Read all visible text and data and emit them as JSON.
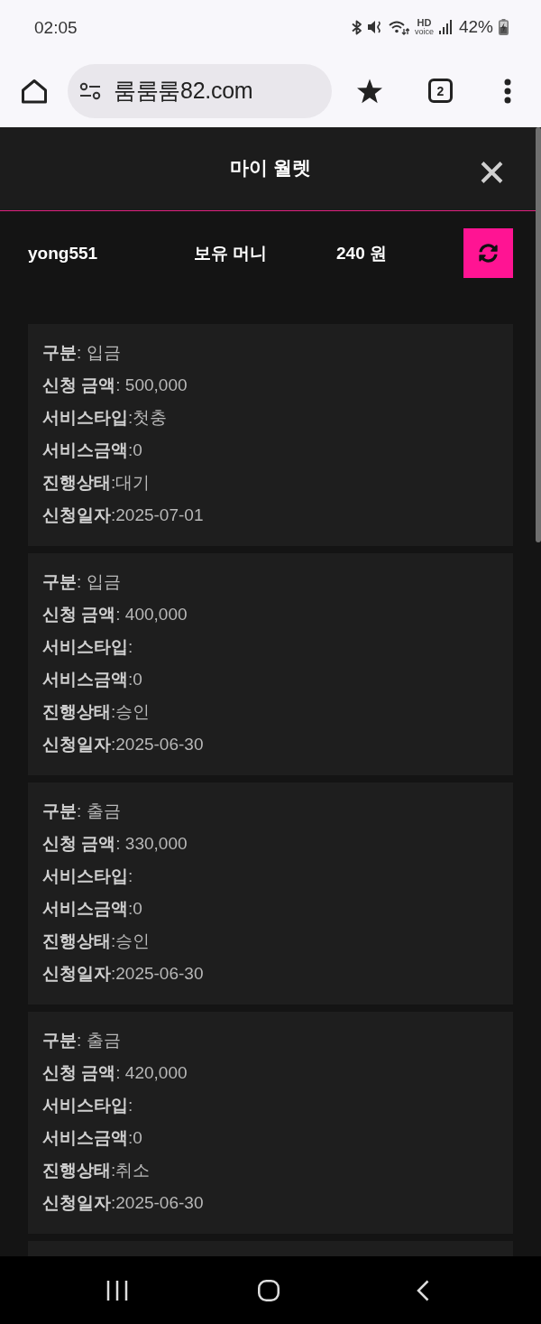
{
  "status_bar": {
    "time": "02:05",
    "hd_label": "HD",
    "voice_label": "voice",
    "battery_percent": "42%"
  },
  "browser": {
    "url": "룸룸룸82.com",
    "tab_count": "2"
  },
  "header": {
    "title": "마이 월렛"
  },
  "wallet": {
    "username": "yong551",
    "balance_label": "보유 머니",
    "balance": "240 원"
  },
  "transactions": [
    {
      "fields": [
        "**구분**: 입금",
        "**신청 금액**: 500,000",
        "**서비스타입**:첫충",
        "**서비스금액**:0",
        "**진행상태**:대기",
        "**신청일자**:2025-07-01"
      ]
    },
    {
      "fields": [
        "**구분**: 입금",
        "**신청 금액**: 400,000",
        "**서비스타입**:",
        "**서비스금액**:0",
        "**진행상태**:승인",
        "**신청일자**:2025-06-30"
      ]
    },
    {
      "fields": [
        "**구분**: 출금",
        "**신청 금액**: 330,000",
        "**서비스타입**:",
        "**서비스금액**:0",
        "**진행상태**:승인",
        "**신청일자**:2025-06-30"
      ]
    },
    {
      "fields": [
        "**구분**: 출금",
        "**신청 금액**: 420,000",
        "**서비스타입**:",
        "**서비스금액**:0",
        "**진행상태**:취소",
        "**신청일자**:2025-06-30"
      ]
    }
  ]
}
